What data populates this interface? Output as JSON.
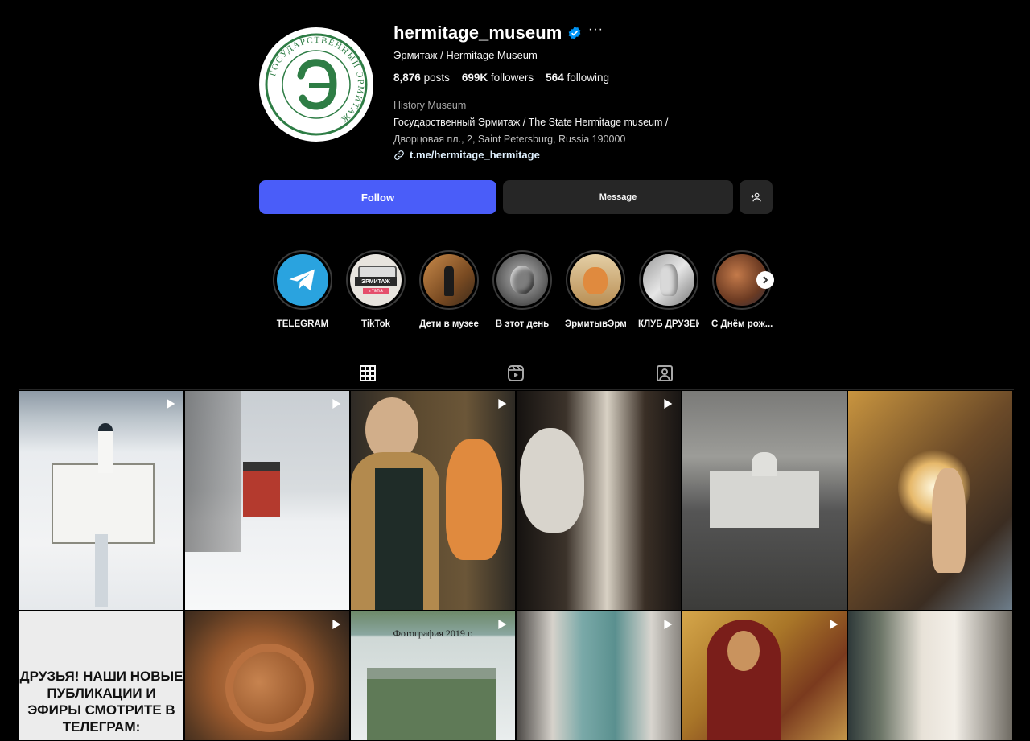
{
  "profile": {
    "username": "hermitage_museum",
    "full_name": "Эрмитаж / Hermitage Museum",
    "more_label": "···",
    "avatar_logo_text": "ГОСУДАРСТВЕННЫЙ ЭРМИТАЖ",
    "stats": {
      "posts_count": "8,876",
      "posts_label": "posts",
      "followers_count": "699K",
      "followers_label": "followers",
      "following_count": "564",
      "following_label": "following"
    },
    "category": "History Museum",
    "bio_line1": "Государственный Эрмитаж / The State Hermitage museum /",
    "bio_line2": "Дворцовая пл., 2, Saint Petersburg, Russia 190000",
    "link": "t.me/hermitage_hermitage"
  },
  "actions": {
    "follow_label": "Follow",
    "message_label": "Message"
  },
  "highlights": [
    {
      "label": "TELEGRAM"
    },
    {
      "label": "TikTok",
      "image_text": "ЭРМИТАЖ",
      "image_subtext": "в TikTok"
    },
    {
      "label": "Дети в музее"
    },
    {
      "label": "В этот день"
    },
    {
      "label": "ЭрмитывЭрм..."
    },
    {
      "label": "КЛУБ ДРУЗЕЙ"
    },
    {
      "label": "С Днём рож..."
    }
  ],
  "tabs": [
    {
      "name": "posts",
      "icon": "grid-icon",
      "active": true
    },
    {
      "name": "reels",
      "icon": "reels-icon",
      "active": false
    },
    {
      "name": "tagged",
      "icon": "tagged-icon",
      "active": false
    }
  ],
  "posts": [
    {
      "text": ""
    },
    {
      "text": ""
    },
    {
      "text": ""
    },
    {
      "text": ""
    },
    {
      "text": ""
    },
    {
      "text": ""
    },
    {
      "text": "ДРУЗЬЯ! НАШИ НОВЫЕ ПУБЛИКАЦИИ И ЭФИРЫ СМОТРИТЕ В ТЕЛЕГРАМ:"
    },
    {
      "text": ""
    },
    {
      "text": "",
      "caption": "Фотография 2019 г."
    },
    {
      "text": ""
    },
    {
      "text": ""
    },
    {
      "text": ""
    }
  ],
  "colors": {
    "background": "#000000",
    "follow_button": "#4a5df9",
    "secondary_button": "#262626",
    "verified": "#0095f6",
    "logo_green": "#2e7d45",
    "telegram": "#2aa3df"
  }
}
